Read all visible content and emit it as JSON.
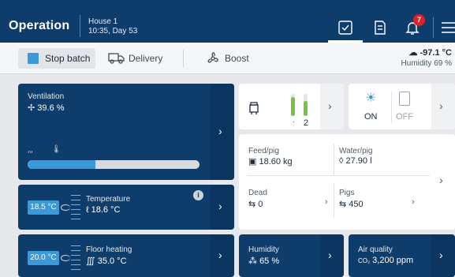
{
  "header": {
    "title": "Operation",
    "house": "House 1",
    "time_day": "10:35, Day 53",
    "notification_count": "7"
  },
  "toolbar": {
    "stop_batch": "Stop batch",
    "delivery": "Delivery",
    "boost": "Boost",
    "outdoor_temp": "-97.1 °C",
    "humidity": "Humidity 69 %"
  },
  "ventilation": {
    "label": "Ventilation",
    "value": "39.6 %",
    "level_percent": 39.6
  },
  "temperature": {
    "setpoint": "18.5 °C",
    "label": "Temperature",
    "value": "18.6 °C",
    "info": "i"
  },
  "floor_heating": {
    "setpoint": "20.0 °C",
    "label": "Floor heating",
    "value": "35.0 °C"
  },
  "feeder": {
    "count": "2"
  },
  "light": {
    "on": "ON",
    "off": "OFF"
  },
  "stats": {
    "feed_label": "Feed/pig",
    "feed_value": "18.60 kg",
    "water_label": "Water/pig",
    "water_value": "27.90 l",
    "dead_label": "Dead",
    "dead_value": "0",
    "pigs_label": "Pigs",
    "pigs_value": "450"
  },
  "humidity_card": {
    "label": "Humidity",
    "value": "65 %"
  },
  "air_quality": {
    "label": "Air quality",
    "value": "3,200 ppm",
    "unit_icon": "CO₂"
  },
  "colors": {
    "navy": "#0e3d6c",
    "accent": "#3a9ad9",
    "green": "#7ac143",
    "alert": "#d9222a"
  }
}
